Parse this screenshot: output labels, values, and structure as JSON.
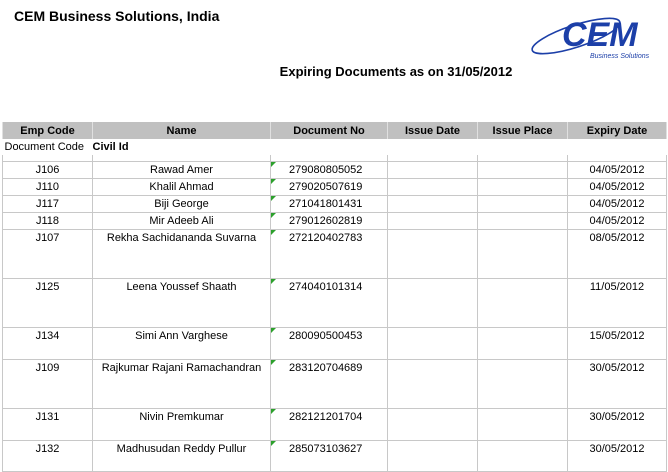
{
  "header": {
    "company": "CEM Business Solutions, India",
    "logo_text": "CEM",
    "logo_subtext": "Business Solutions",
    "title": "Expiring Documents as on 31/05/2012",
    "brand_color": "#1c3fa8"
  },
  "table": {
    "columns": [
      "Emp Code",
      "Name",
      "Document No",
      "Issue Date",
      "Issue Place",
      "Expiry Date"
    ],
    "group_label": "Document Code",
    "group_value": "Civil Id",
    "rows": [
      {
        "code": "J106",
        "name": "Rawad Amer",
        "doc_no": "279080805052",
        "issue_date": "",
        "issue_place": "",
        "expiry": "04/05/2012"
      },
      {
        "code": "J110",
        "name": "Khalil Ahmad",
        "doc_no": "279020507619",
        "issue_date": "",
        "issue_place": "",
        "expiry": "04/05/2012"
      },
      {
        "code": "J117",
        "name": "Biji George",
        "doc_no": "271041801431",
        "issue_date": "",
        "issue_place": "",
        "expiry": "04/05/2012"
      },
      {
        "code": "J118",
        "name": "Mir Adeeb Ali",
        "doc_no": "279012602819",
        "issue_date": "",
        "issue_place": "",
        "expiry": "04/05/2012"
      },
      {
        "code": "J107",
        "name": "Rekha Sachidananda Suvarna",
        "doc_no": "272120402783",
        "issue_date": "",
        "issue_place": "",
        "expiry": "08/05/2012"
      },
      {
        "code": "J125",
        "name": "Leena Youssef Shaath",
        "doc_no": "274040101314",
        "issue_date": "",
        "issue_place": "",
        "expiry": "11/05/2012"
      },
      {
        "code": "J134",
        "name": "Simi Ann Varghese",
        "doc_no": "280090500453",
        "issue_date": "",
        "issue_place": "",
        "expiry": "15/05/2012"
      },
      {
        "code": "J109",
        "name": "Rajkumar Rajani Ramachandran",
        "doc_no": "283120704689",
        "issue_date": "",
        "issue_place": "",
        "expiry": "30/05/2012"
      },
      {
        "code": "J131",
        "name": "Nivin Premkumar",
        "doc_no": "282121201704",
        "issue_date": "",
        "issue_place": "",
        "expiry": "30/05/2012"
      },
      {
        "code": "J132",
        "name": "Madhusudan Reddy Pullur",
        "doc_no": "285073103627",
        "issue_date": "",
        "issue_place": "",
        "expiry": "30/05/2012"
      }
    ]
  }
}
